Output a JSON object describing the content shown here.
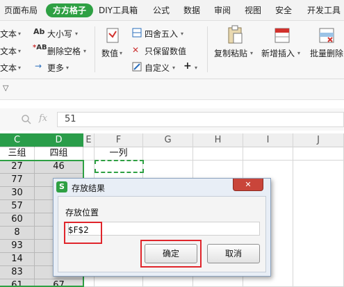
{
  "menubar": {
    "items": [
      "页面布局",
      "方方格子",
      "DIY工具箱",
      "公式",
      "数据",
      "审阅",
      "视图",
      "安全",
      "开发工具"
    ],
    "active_index": 1,
    "active_color": "#2ea043"
  },
  "ribbon": {
    "text_items": [
      "文本",
      "文本",
      "文本"
    ],
    "case_label": "大小写",
    "delete_space_label": "删除空格",
    "more_label": "更多",
    "numeric_label": "数值",
    "round_label": "四舍五入",
    "keep_value_label": "只保留数值",
    "custom_label": "自定义",
    "plus_label": "+",
    "copy_paste_label": "复制粘贴",
    "insert_label": "新增插入",
    "batch_delete_label": "批量删除",
    "ab_icon_label": "Ab",
    "ab2_icon_label": "AB"
  },
  "collapse_glyph": "▽",
  "formula_bar": {
    "fx_label": "fx",
    "value": "51"
  },
  "grid": {
    "columns": [
      "C",
      "D",
      "E",
      "F",
      "G",
      "H",
      "I",
      "J"
    ],
    "selected_columns": [
      "C",
      "D"
    ],
    "header_row": [
      "三组",
      "四组",
      "",
      "一列"
    ],
    "c_values": [
      "27",
      "77",
      "30",
      "57",
      "60",
      "8",
      "93",
      "14",
      "83",
      "61"
    ],
    "d_values": [
      "46",
      "",
      "",
      "",
      "",
      "",
      "",
      "",
      "",
      "67"
    ]
  },
  "dialog": {
    "title": "存放结果",
    "app_icon_label": "S",
    "field_label": "存放位置",
    "field_value": "$F$2",
    "ok_label": "确定",
    "cancel_label": "取消",
    "close_glyph": "✕",
    "highlight_color": "#e0252b",
    "close_color": "#c9453a"
  }
}
